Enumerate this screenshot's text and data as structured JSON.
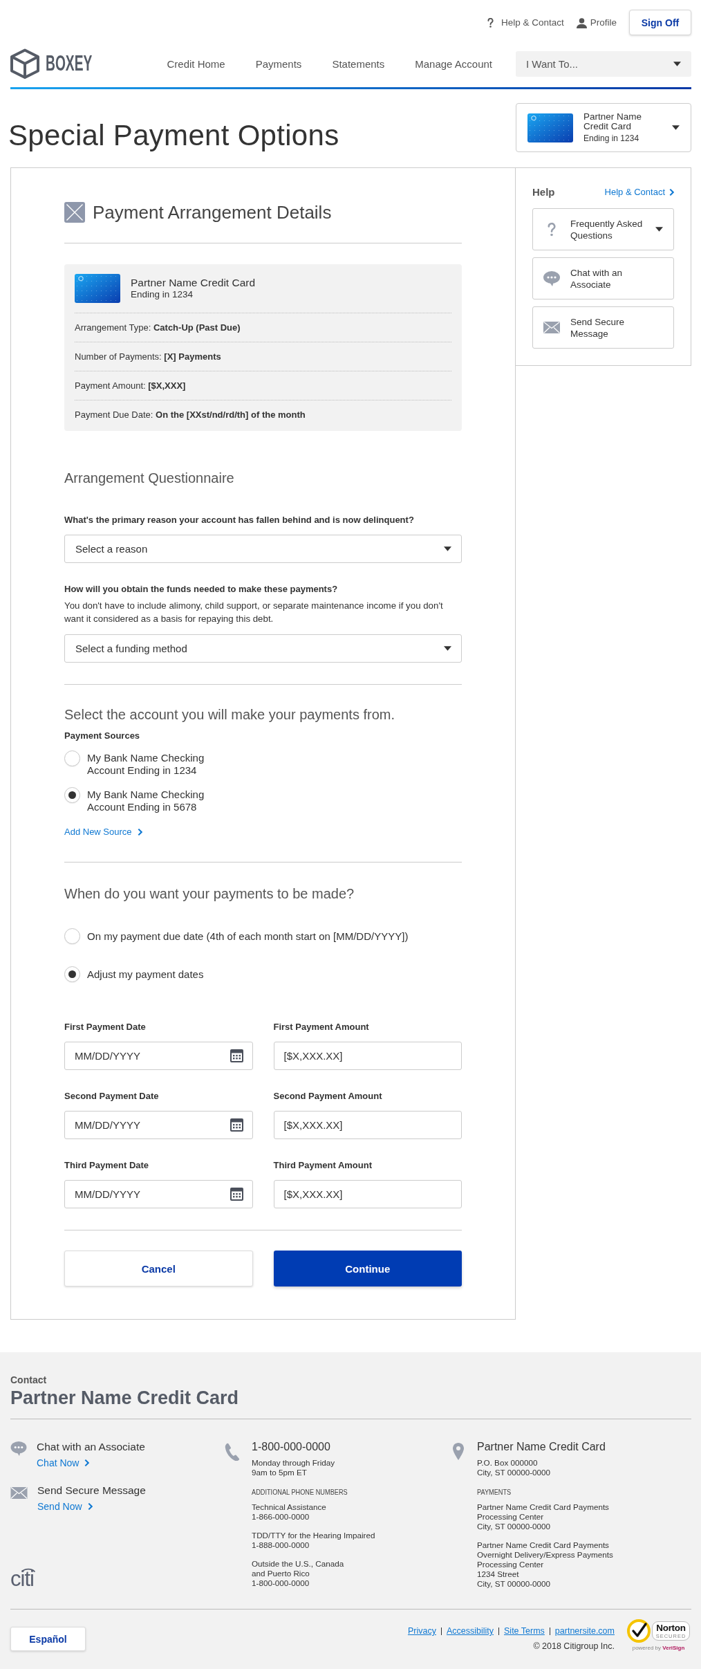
{
  "header": {
    "utility_links": [
      {
        "kind": "help",
        "label": "Help & Contact"
      },
      {
        "kind": "profile",
        "label": "Profile"
      }
    ],
    "sign_off": "Sign Off",
    "logo_text": "BOXEY",
    "nav": [
      "Credit Home",
      "Payments",
      "Statements",
      "Manage Account"
    ],
    "menu": "I Want To..."
  },
  "page_title": "Special Payment Options",
  "card_selector": {
    "name": "Partner Name Credit Card",
    "ending": "Ending in 1234"
  },
  "details": {
    "title": "Payment Arrangement Details",
    "card_name": "Partner Name Credit Card",
    "card_ending": "Ending in 1234",
    "rows": [
      "Arrangement Type: **Catch-Up (Past Due)**",
      "Number of Payments: **[X] Payments**",
      "Payment Amount: **[$X,XXX]**",
      "Payment Due Date: **On the [XXst/nd/rd/th] of the month**"
    ]
  },
  "questionnaire": {
    "title": "Arrangement Questionnaire",
    "questions": [
      {
        "label": "What's the primary reason your account has fallen behind and is now delinquent?",
        "placeholder": "Select a reason"
      },
      {
        "label": "How will you obtain the funds needed to make these payments?",
        "note": "You don't have to include alimony, child support, or separate maintenance income if you don't want it considered as a basis for repaying this debt.",
        "placeholder": "Select a funding method"
      }
    ]
  },
  "payment_sources": {
    "title": "Select the account you will make your payments from.",
    "label": "Payment Sources",
    "options": [
      {
        "lines": [
          "My Bank Name Checking",
          "Account Ending in 1234"
        ],
        "selected": false
      },
      {
        "lines": [
          "My Bank Name Checking",
          "Account Ending in 5678"
        ],
        "selected": true
      }
    ],
    "add_link": "Add New Source"
  },
  "schedule": {
    "title": "When do you want your payments to be made?",
    "options": [
      {
        "label": "On my payment due date (4th of each month start on [MM/DD/YYYY])",
        "selected": false
      },
      {
        "label": "Adjust my payment dates",
        "selected": true
      }
    ],
    "payments": [
      {
        "date_label": "First Payment Date",
        "date_placeholder": "MM/DD/YYYY",
        "amount_label": "First Payment Amount",
        "amount_placeholder": "[$X,XXX.XX]"
      },
      {
        "date_label": "Second Payment Date",
        "date_placeholder": "MM/DD/YYYY",
        "amount_label": "Second Payment Amount",
        "amount_placeholder": "[$X,XXX.XX]"
      },
      {
        "date_label": "Third Payment Date",
        "date_placeholder": "MM/DD/YYYY",
        "amount_label": "Third Payment Amount",
        "amount_placeholder": "[$X,XXX.XX]"
      }
    ]
  },
  "actions": [
    {
      "kind": "secondary",
      "label": "Cancel"
    },
    {
      "kind": "primary",
      "label": "Continue"
    }
  ],
  "help": {
    "title": "Help",
    "link": "Help & Contact",
    "items": [
      {
        "kind": "faq",
        "label": "Frequently Asked Questions"
      },
      {
        "kind": "chat",
        "label": "Chat with an Associate"
      },
      {
        "kind": "message",
        "label": "Send Secure Message"
      }
    ]
  },
  "footer": {
    "label": "Contact",
    "title": "Partner Name Credit Card",
    "channels": [
      {
        "kind": "chat",
        "title": "Chat with an Associate",
        "link": "Chat Now"
      },
      {
        "kind": "message",
        "title": "Send Secure Message",
        "link": "Send Now"
      }
    ],
    "logo": "citi",
    "phone": {
      "number": "1-800-000-0000",
      "hours": [
        "Monday through Friday",
        "9am to 5pm ET"
      ],
      "heading": "ADDITIONAL PHONE NUMBERS",
      "entries": [
        [
          "Technical Assistance",
          "1-866-000-0000"
        ],
        [
          "TDD/TTY for the Hearing Impaired",
          "1-888-000-0000"
        ],
        [
          "Outside the U.S., Canada",
          "and Puerto Rico",
          "1-800-000-0000"
        ]
      ]
    },
    "mail": {
      "title": "Partner Name Credit Card",
      "address": [
        "P.O. Box 000000",
        "City, ST 00000-0000"
      ],
      "heading": "PAYMENTS",
      "entries": [
        [
          "Partner Name Credit Card Payments",
          "Processing Center",
          "City, ST 00000-0000"
        ],
        [
          "Partner Name Credit Card Payments",
          "Overnight Delivery/Express Payments",
          "Processing Center",
          "1234 Street",
          "City, ST 00000-0000"
        ]
      ]
    },
    "language": "Español",
    "links": [
      "Privacy",
      "Accessibility",
      "Site Terms",
      "partnersite.com"
    ],
    "copyright": "© 2018 Citigroup Inc.",
    "badge": {
      "name": "Norton",
      "status": "SECURED",
      "powered_by": "powered by",
      "brand": "VeriSign"
    }
  }
}
